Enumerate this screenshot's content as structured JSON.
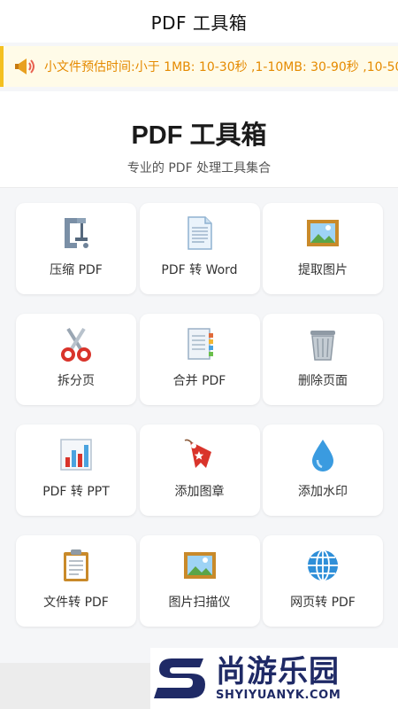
{
  "app": {
    "title": "PDF 工具箱"
  },
  "notice": {
    "text": "小文件预估时间:小于 1MB: 10-30秒 ,1-10MB: 30-90秒 ,10-50",
    "icon": "megaphone-icon"
  },
  "hero": {
    "title": "PDF 工具箱",
    "subtitle": "专业的 PDF 处理工具集合"
  },
  "tools": [
    {
      "label": "压缩 PDF",
      "icon": "clamp-icon"
    },
    {
      "label": "PDF 转 Word",
      "icon": "document-icon"
    },
    {
      "label": "提取图片",
      "icon": "framed-picture-icon"
    },
    {
      "label": "拆分页",
      "icon": "scissors-icon"
    },
    {
      "label": "合并 PDF",
      "icon": "binder-icon"
    },
    {
      "label": "删除页面",
      "icon": "trash-icon"
    },
    {
      "label": "PDF 转 PPT",
      "icon": "bar-chart-icon"
    },
    {
      "label": "添加图章",
      "icon": "stamp-tag-icon"
    },
    {
      "label": "添加水印",
      "icon": "droplet-icon"
    },
    {
      "label": "文件转 PDF",
      "icon": "clipboard-icon"
    },
    {
      "label": "图片扫描仪",
      "icon": "framed-picture-icon"
    },
    {
      "label": "网页转 PDF",
      "icon": "globe-icon"
    }
  ],
  "watermark": {
    "name": "尚游乐园",
    "domain": "SHYIYUANYK.COM"
  },
  "colors": {
    "accent": "#f4c020",
    "notice_text": "#e58a00",
    "watermark": "#1f2a66"
  }
}
